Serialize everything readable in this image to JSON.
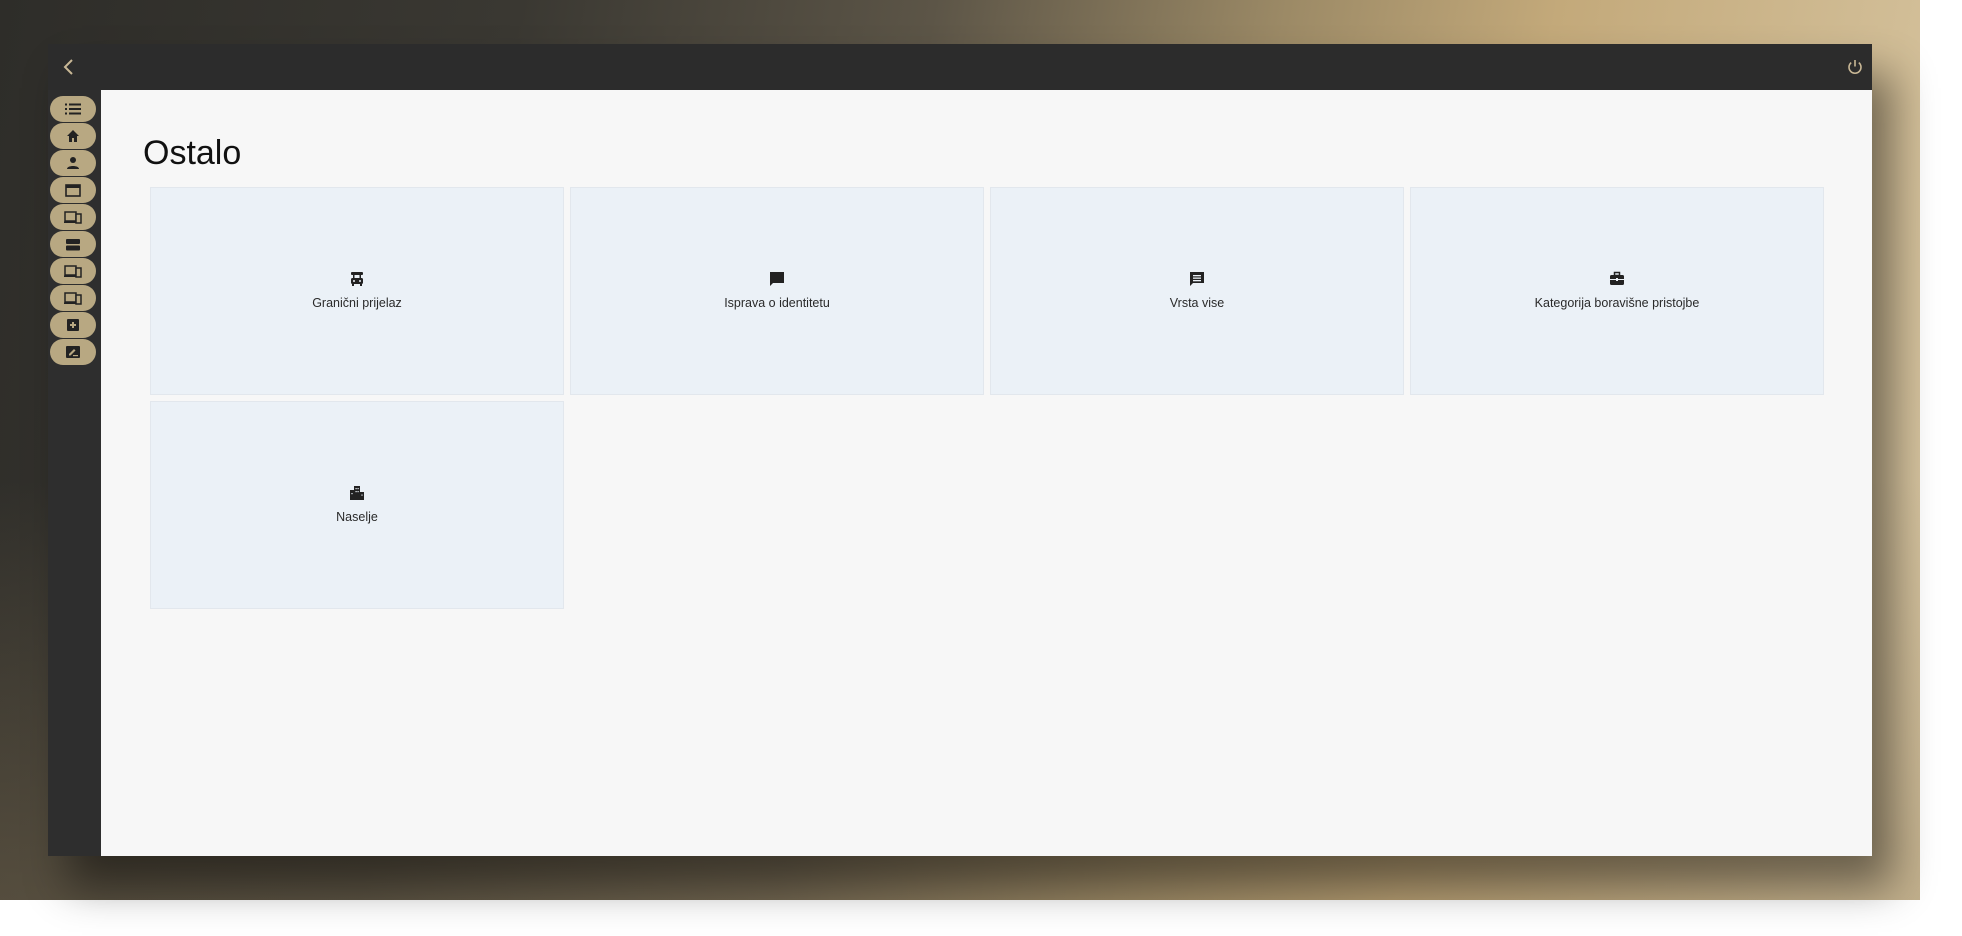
{
  "colors": {
    "topbar": "#2c2c2c",
    "sidebar": "#2e2e2e",
    "sidebar_pill": "#b8a882",
    "content_bg": "#f7f7f7",
    "tile_bg": "#ebf1f7",
    "header_icon": "#c9b896"
  },
  "header": {
    "back_icon": "chevron-left-icon",
    "power_icon": "power-icon"
  },
  "sidebar": {
    "items": [
      {
        "icon": "list-icon"
      },
      {
        "icon": "home-icon"
      },
      {
        "icon": "person-icon"
      },
      {
        "icon": "window-icon"
      },
      {
        "icon": "devices-icon"
      },
      {
        "icon": "storage-icon"
      },
      {
        "icon": "devices-icon"
      },
      {
        "icon": "devices-icon"
      },
      {
        "icon": "medical-box-icon"
      },
      {
        "icon": "edit-note-icon"
      }
    ]
  },
  "main": {
    "title": "Ostalo",
    "tiles": [
      {
        "label": "Granični prijelaz",
        "icon": "border-crossing-icon"
      },
      {
        "label": "Isprava o identitetu",
        "icon": "chat-bubble-icon"
      },
      {
        "label": "Vrsta vise",
        "icon": "message-icon"
      },
      {
        "label": "Kategorija boravišne pristojbe",
        "icon": "briefcase-icon"
      },
      {
        "label": "Naselje",
        "icon": "city-icon"
      }
    ]
  }
}
